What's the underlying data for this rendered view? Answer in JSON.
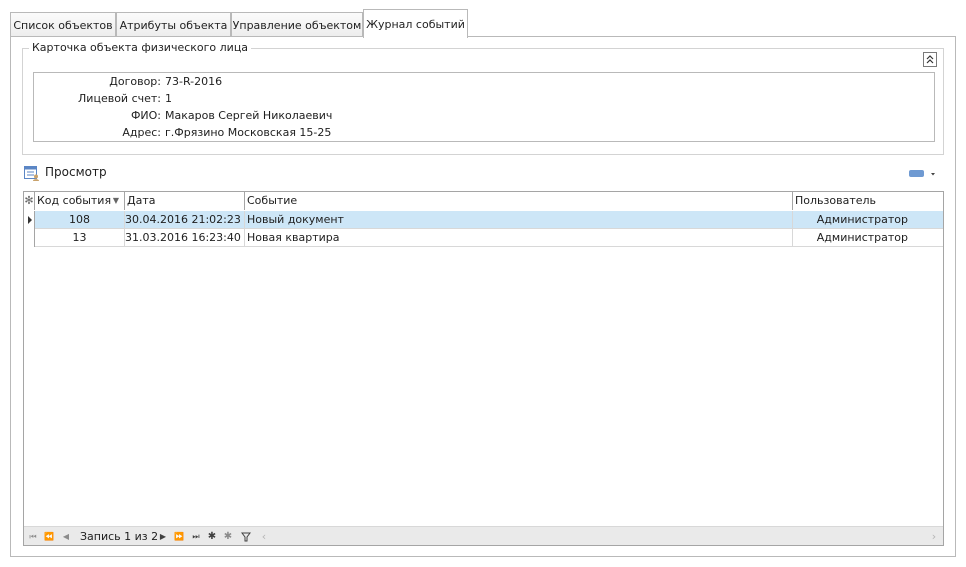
{
  "tabs": [
    {
      "label": "Список объектов"
    },
    {
      "label": "Атрибуты объекта"
    },
    {
      "label": "Управление объектом"
    },
    {
      "label": "Журнал событий"
    }
  ],
  "card": {
    "title": "Карточка объекта физического лица",
    "collapse_icon": "double-chevron-up-icon",
    "fields": [
      {
        "label": "Договор:",
        "value": "73-R-2016"
      },
      {
        "label": "Лицевой счет:",
        "value": "1"
      },
      {
        "label": "ФИО:",
        "value": "Макаров Сергей Николаевич"
      },
      {
        "label": "Адрес:",
        "value": "г.Фрязино Московская 15-25"
      }
    ]
  },
  "view": {
    "title": "Просмотр",
    "icon": "table-view-icon",
    "layout_icon": "layout-options-icon"
  },
  "grid": {
    "columns": [
      {
        "label": "Код события"
      },
      {
        "label": "Дата"
      },
      {
        "label": "Событие"
      },
      {
        "label": "Пользователь"
      }
    ],
    "rows": [
      {
        "code": "108",
        "date": "30.04.2016 21:02:23",
        "event": "Новый документ",
        "user": "Администратор"
      },
      {
        "code": "13",
        "date": "31.03.2016 16:23:40",
        "event": "Новая квартира",
        "user": "Администратор"
      }
    ],
    "selected_row": 0
  },
  "navigator": {
    "record_text": "Запись 1 из 2"
  },
  "colors": {
    "selection": "#cde6f7",
    "border": "#a5a5a5",
    "accent": "#5b86c5"
  }
}
